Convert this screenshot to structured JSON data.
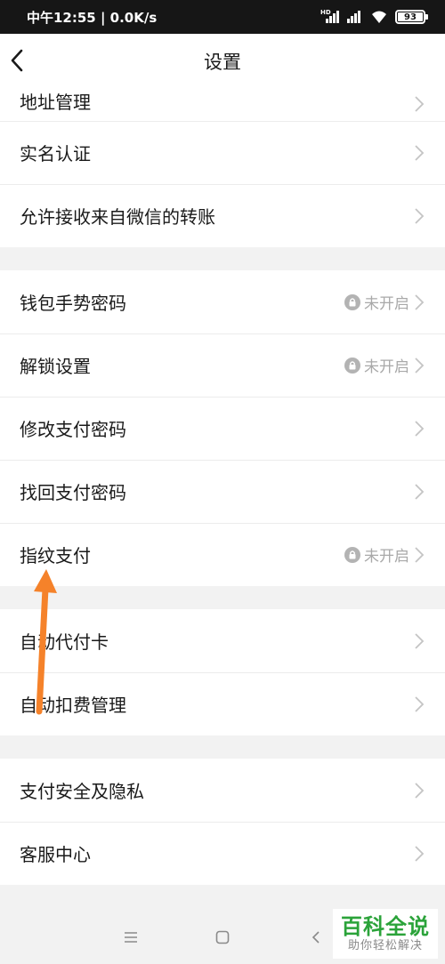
{
  "status_bar": {
    "time_speed": "中午12:55 | 0.0K/s",
    "battery": "93"
  },
  "header": {
    "title": "设置"
  },
  "groups": [
    {
      "items": [
        {
          "label": "地址管理",
          "status": ""
        },
        {
          "label": "实名认证",
          "status": ""
        },
        {
          "label": "允许接收来自微信的转账",
          "status": ""
        }
      ]
    },
    {
      "items": [
        {
          "label": "钱包手势密码",
          "status": "未开启"
        },
        {
          "label": "解锁设置",
          "status": "未开启"
        },
        {
          "label": "修改支付密码",
          "status": ""
        },
        {
          "label": "找回支付密码",
          "status": ""
        },
        {
          "label": "指纹支付",
          "status": "未开启"
        }
      ]
    },
    {
      "items": [
        {
          "label": "自动代付卡",
          "status": ""
        },
        {
          "label": "自动扣费管理",
          "status": ""
        }
      ]
    },
    {
      "items": [
        {
          "label": "支付安全及隐私",
          "status": ""
        },
        {
          "label": "客服中心",
          "status": ""
        }
      ]
    }
  ],
  "watermark": {
    "title": "百科全说",
    "subtitle": "助你轻松解决"
  },
  "colors": {
    "annotation_arrow": "#f5822a",
    "watermark_green": "#2ba33a"
  }
}
